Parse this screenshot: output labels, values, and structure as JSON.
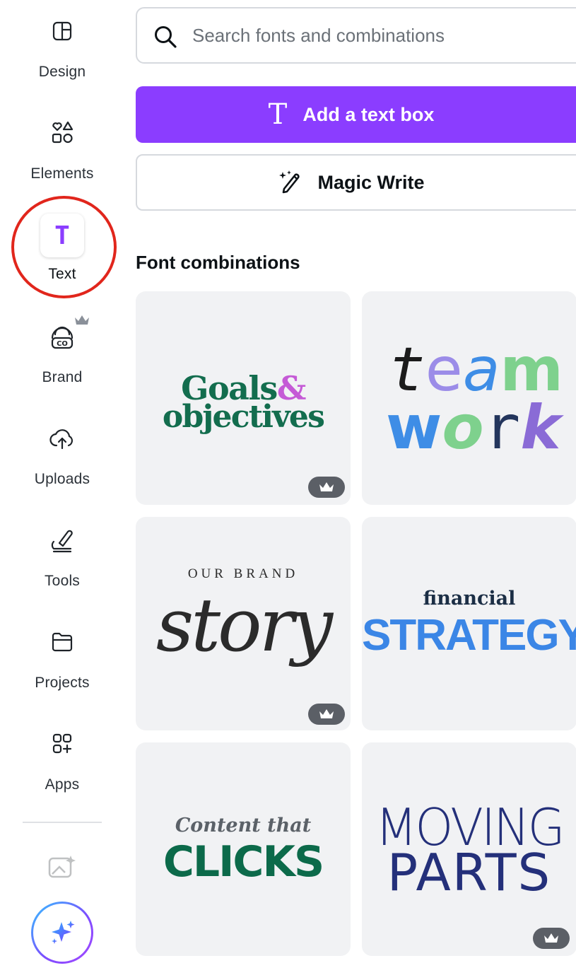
{
  "sidebar": {
    "items": [
      {
        "id": "design",
        "label": "Design",
        "icon": "layout-icon"
      },
      {
        "id": "elements",
        "label": "Elements",
        "icon": "shapes-icon"
      },
      {
        "id": "text",
        "label": "Text",
        "icon": "text-t-icon",
        "active": true
      },
      {
        "id": "brand",
        "label": "Brand",
        "icon": "brand-kit-icon",
        "premium": true
      },
      {
        "id": "uploads",
        "label": "Uploads",
        "icon": "cloud-upload-icon"
      },
      {
        "id": "tools",
        "label": "Tools",
        "icon": "pen-tool-icon"
      },
      {
        "id": "projects",
        "label": "Projects",
        "icon": "folder-icon"
      },
      {
        "id": "apps",
        "label": "Apps",
        "icon": "apps-grid-icon"
      }
    ],
    "highlight_color": "#e1261c"
  },
  "search": {
    "placeholder": "Search fonts and combinations"
  },
  "actions": {
    "add_text_box": "Add a text box",
    "magic_write": "Magic Write"
  },
  "section": {
    "title": "Font combinations"
  },
  "cards": [
    {
      "id": "goals",
      "line1_a": "Goals",
      "line1_b": "&",
      "line2": "objectives",
      "premium": true
    },
    {
      "id": "teamwork",
      "line1": [
        "t",
        "e",
        "a",
        "m"
      ],
      "line2": [
        "w",
        "o",
        "r",
        "k"
      ],
      "premium": false
    },
    {
      "id": "story",
      "line1": "OUR BRAND",
      "line2": "story",
      "premium": true
    },
    {
      "id": "financial",
      "line1": "financial",
      "line2": "STRATEGY",
      "premium": false
    },
    {
      "id": "clicks",
      "line1": "Content that",
      "line2": "CLICKS",
      "premium": false
    },
    {
      "id": "moving",
      "line1": "MOVING",
      "line2": "PARTS",
      "premium": true
    }
  ],
  "colors": {
    "accent": "#8b3dff",
    "premium_badge": "#5b5f66",
    "card_bg": "#f1f2f4"
  }
}
